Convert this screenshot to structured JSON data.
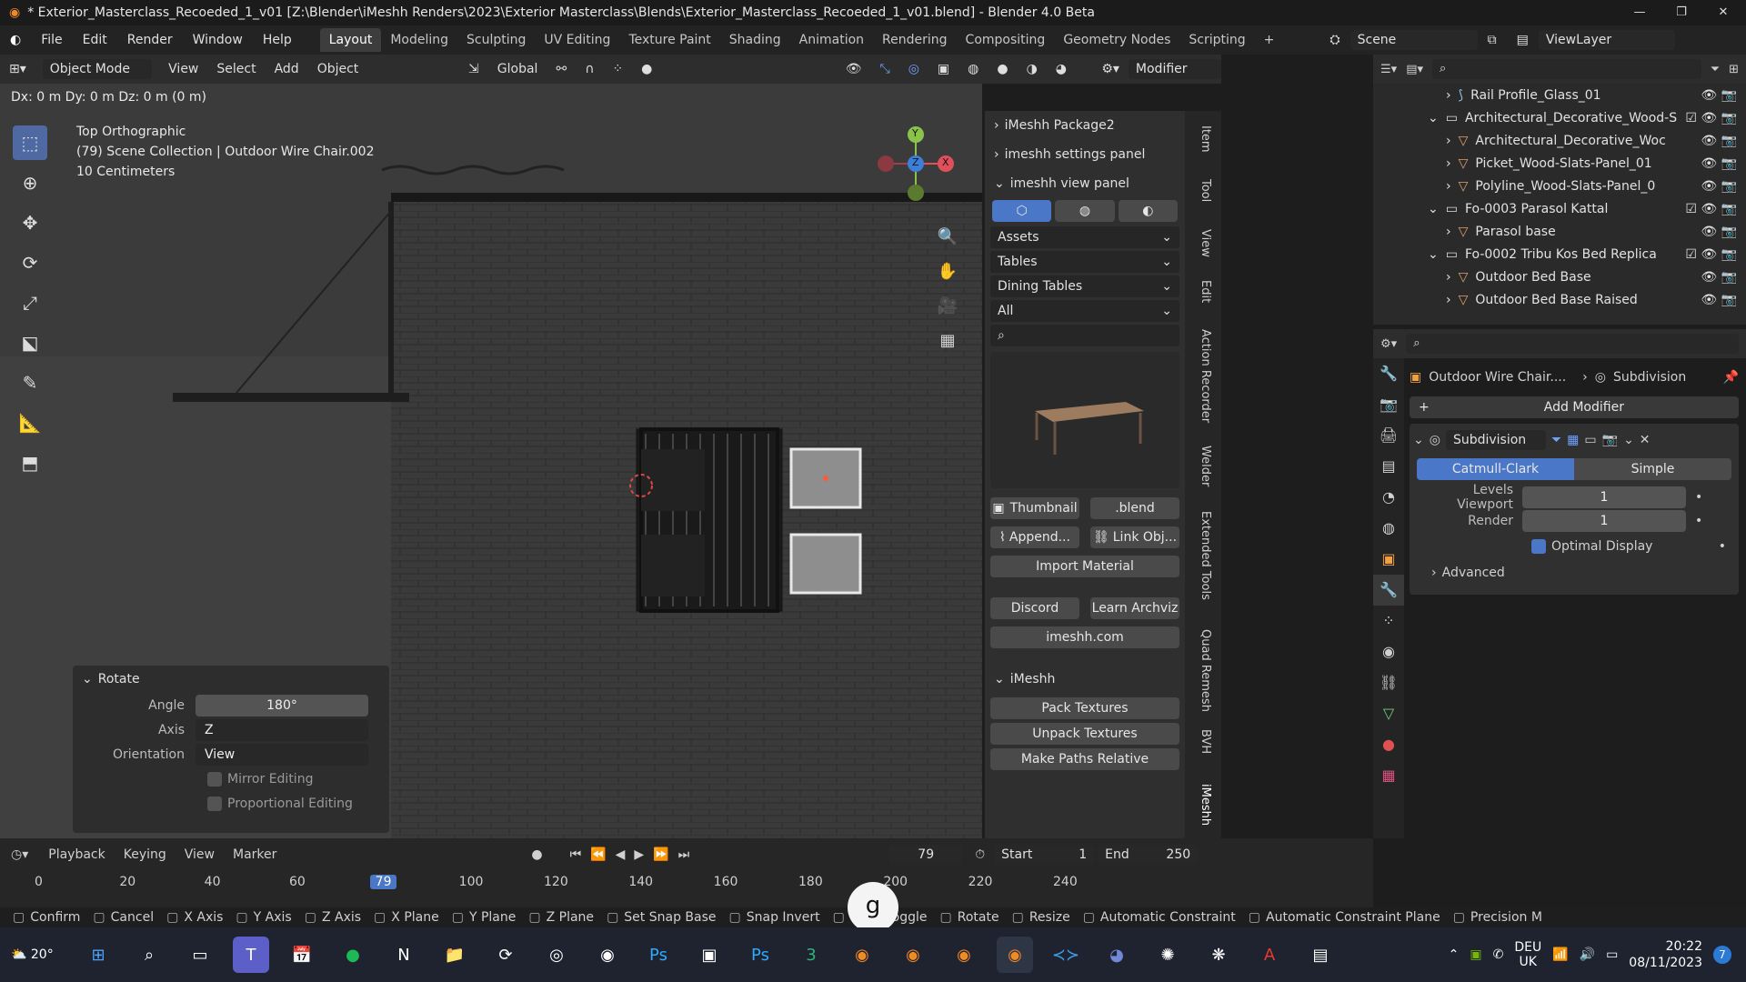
{
  "titlebar": {
    "title": "* Exterior_Masterclass_Recoeded_1_v01 [Z:\\Blender\\iMeshh Renders\\2023\\Exterior Masterclass\\Blends\\Exterior_Masterclass_Recoeded_1_v01.blend] - Blender 4.0 Beta"
  },
  "menu": {
    "items": [
      "File",
      "Edit",
      "Render",
      "Window",
      "Help"
    ]
  },
  "workspace_tabs": [
    "Layout",
    "Modeling",
    "Sculpting",
    "UV Editing",
    "Texture Paint",
    "Shading",
    "Animation",
    "Rendering",
    "Compositing",
    "Geometry Nodes",
    "Scripting"
  ],
  "scene": {
    "label": "Scene",
    "viewlayer": "ViewLayer"
  },
  "viewport_header": {
    "mode": "Object Mode",
    "menus": [
      "View",
      "Select",
      "Add",
      "Object"
    ],
    "orientation": "Global",
    "modifier_dropdown": "Modifier"
  },
  "transform_readout": "Dx: 0 m  Dy: 0 m  Dz: 0 m (0 m)",
  "overlay": {
    "view_name": "Top Orthographic",
    "collection": "(79) Scene Collection | Outdoor Wire Chair.002",
    "scale": "10 Centimeters"
  },
  "gizmo": {
    "y": "Y",
    "z": "Z",
    "x": "X"
  },
  "npanel": {
    "package": "iMeshh Package2",
    "settings": "imeshh settings panel",
    "view_panel": "imeshh view panel",
    "dropdowns": [
      "Assets",
      "Tables",
      "Dining Tables",
      "All"
    ],
    "thumbnail": "Thumbnail",
    "blend": ".blend",
    "append": "Append...",
    "link": "Link Obj...",
    "import_material": "Import Material",
    "discord": "Discord",
    "learn": "Learn Archviz",
    "site": "imeshh.com",
    "imeshh_section": "iMeshh",
    "pack": "Pack Textures",
    "unpack": "Unpack Textures",
    "paths": "Make Paths Relative"
  },
  "side_tabs": [
    "Item",
    "Tool",
    "View",
    "Edit",
    "Action Recorder",
    "Welder",
    "Extended Tools",
    "Quad Remesh",
    "BVH",
    "iMeshh"
  ],
  "outliner": [
    {
      "indent": 2,
      "label": "Rail Profile_Glass_01",
      "type": "curve"
    },
    {
      "indent": 1,
      "label": "Architectural_Decorative_Wood-S",
      "type": "collection"
    },
    {
      "indent": 2,
      "label": "Architectural_Decorative_Woc",
      "type": "mesh"
    },
    {
      "indent": 2,
      "label": "Picket_Wood-Slats-Panel_01",
      "type": "mesh"
    },
    {
      "indent": 2,
      "label": "Polyline_Wood-Slats-Panel_0",
      "type": "mesh"
    },
    {
      "indent": 1,
      "label": "Fo-0003 Parasol Kattal",
      "type": "collection"
    },
    {
      "indent": 2,
      "label": "Parasol base",
      "type": "mesh"
    },
    {
      "indent": 1,
      "label": "Fo-0002 Tribu Kos Bed Replica",
      "type": "collection"
    },
    {
      "indent": 2,
      "label": "Outdoor Bed Base",
      "type": "mesh"
    },
    {
      "indent": 2,
      "label": "Outdoor Bed Base Raised",
      "type": "mesh"
    }
  ],
  "properties": {
    "object": "Outdoor Wire Chair....",
    "modifier_crumb": "Subdivision",
    "add_modifier": "Add Modifier",
    "modifier_name": "Subdivision",
    "catmull": "Catmull-Clark",
    "simple": "Simple",
    "levels_label": "Levels Viewport",
    "levels_value": "1",
    "render_label": "Render",
    "render_value": "1",
    "optimal": "Optimal Display",
    "advanced": "Advanced"
  },
  "redo": {
    "title": "Rotate",
    "angle_label": "Angle",
    "angle": "180°",
    "axis_label": "Axis",
    "axis": "Z",
    "orient_label": "Orientation",
    "orient": "View",
    "mirror": "Mirror Editing",
    "proportional": "Proportional Editing"
  },
  "timeline": {
    "menus": [
      "Playback",
      "Keying",
      "View",
      "Marker"
    ],
    "current": "79",
    "start_label": "Start",
    "start": "1",
    "end_label": "End",
    "end": "250",
    "ticks": [
      "0",
      "20",
      "40",
      "60",
      "79",
      "100",
      "120",
      "140",
      "160",
      "180",
      "200",
      "220",
      "240"
    ]
  },
  "statusbar": [
    "Confirm",
    "Cancel",
    "X Axis",
    "Y Axis",
    "Z Axis",
    "X Plane",
    "Y Plane",
    "Z Plane",
    "Set Snap Base",
    "Snap Invert",
    "Snap Toggle",
    "Rotate",
    "Resize",
    "Automatic Constraint",
    "Automatic Constraint Plane",
    "Precision M"
  ],
  "keycap": "g",
  "taskbar": {
    "weather": "20°",
    "lang": "DEU",
    "region": "UK",
    "time": "20:22",
    "date": "08/11/2023",
    "badge": "7"
  }
}
